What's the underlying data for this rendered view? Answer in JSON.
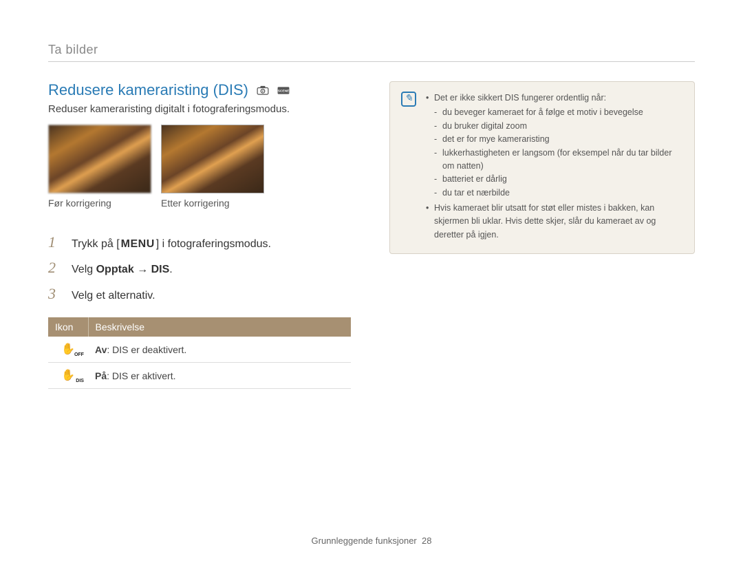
{
  "breadcrumb": "Ta bilder",
  "heading": "Redusere kameraristing (DIS)",
  "mode_icons": {
    "a": "camera-program-icon",
    "b": "scene-icon"
  },
  "subtitle": "Reduser kameraristing digitalt i fotograferingsmodus.",
  "captions": {
    "before": "Før korrigering",
    "after": "Etter korrigering"
  },
  "steps": [
    {
      "num": "1",
      "pre": "Trykk på [",
      "key": "MENU",
      "post": "] i fotograferingsmodus."
    },
    {
      "num": "2",
      "text": "Velg ",
      "bold1": "Opptak",
      "arrow": " → ",
      "bold2": "DIS",
      "tail": "."
    },
    {
      "num": "3",
      "text": "Velg et alternativ."
    }
  ],
  "table": {
    "headers": {
      "icon": "Ikon",
      "desc": "Beskrivelse"
    },
    "rows": [
      {
        "icon_sub": "OFF",
        "bold": "Av",
        "rest": ": DIS er deaktivert."
      },
      {
        "icon_sub": "DIS",
        "bold": "På",
        "rest": ": DIS er aktivert."
      }
    ]
  },
  "note": {
    "intro": "Det er ikke sikkert DIS fungerer ordentlig når:",
    "subitems": [
      "du beveger kameraet for å følge et motiv i bevegelse",
      "du bruker digital zoom",
      "det er for mye kameraristing",
      "lukkerhastigheten er langsom (for eksempel når du tar bilder om natten)",
      "batteriet er dårlig",
      "du tar et nærbilde"
    ],
    "extra": "Hvis kameraet blir utsatt for støt eller mistes i bakken, kan skjermen bli uklar. Hvis dette skjer, slår du kameraet av og deretter på igjen."
  },
  "footer": {
    "section": "Grunnleggende funksjoner",
    "page": "28"
  }
}
